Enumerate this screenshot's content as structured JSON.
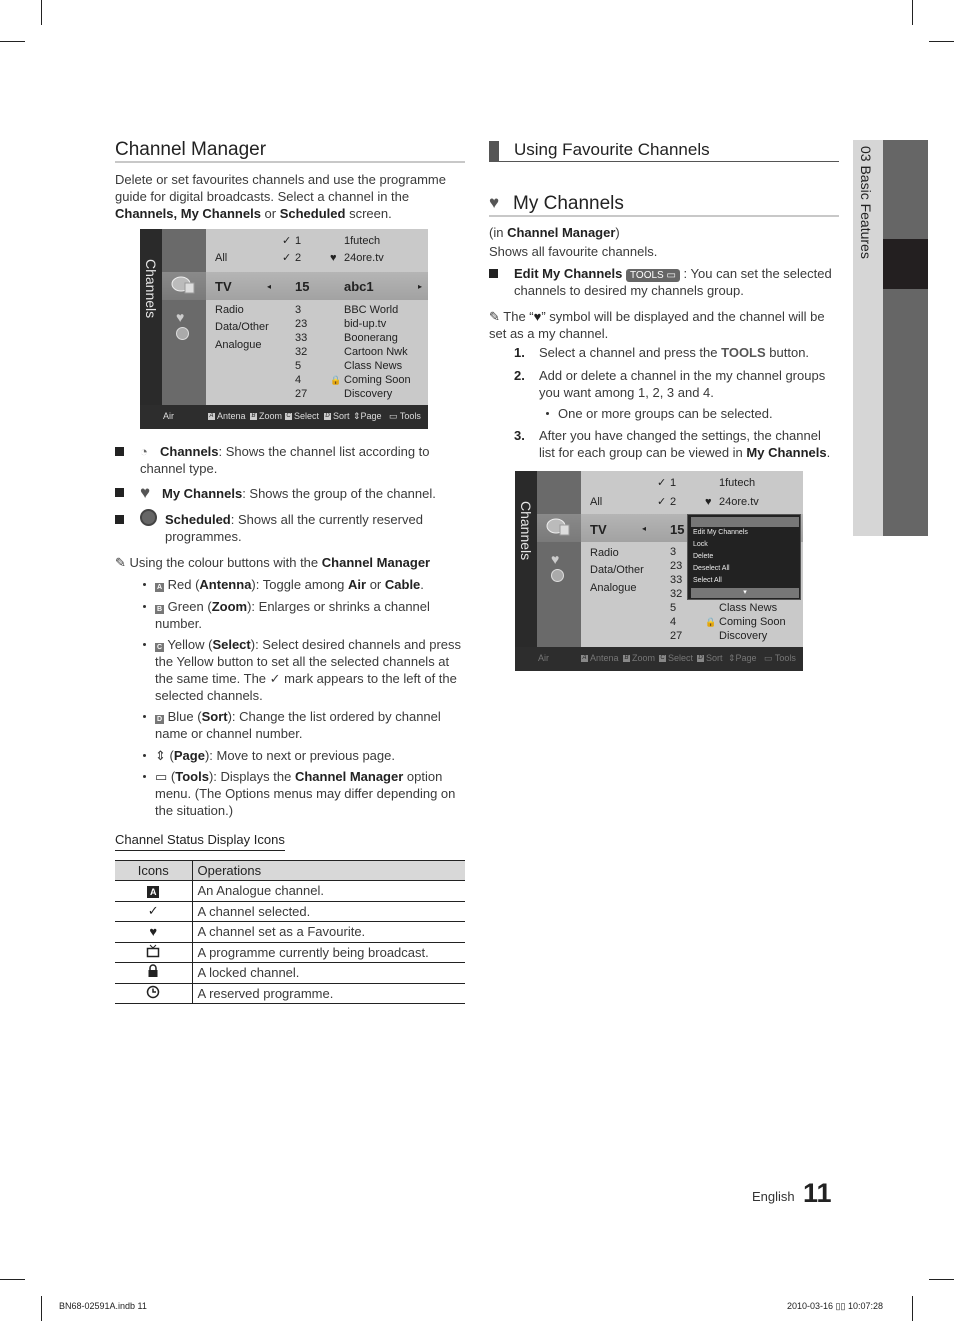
{
  "left": {
    "title": "Channel Manager",
    "intro": {
      "t1": "Delete or set favourites channels and use the programme guide for digital broadcasts. Select a channel in the ",
      "b1": "Channels, My Channels",
      "t2": " or ",
      "b2": "Scheduled",
      "t3": " screen."
    },
    "screen": {
      "side_label": "Channels",
      "categories": [
        "All",
        "TV",
        "Radio",
        "Data/Other",
        "Analogue"
      ],
      "numbers": [
        "1",
        "2",
        "15",
        "3",
        "23",
        "33",
        "32",
        "5",
        "4",
        "27"
      ],
      "names": [
        "1futech",
        "24ore.tv",
        "abc1",
        "BBC World",
        "bid-up.tv",
        "Boonerang",
        "Cartoon Nwk",
        "Class News",
        "Coming Soon",
        "Discovery"
      ],
      "footer": {
        "source": "Air",
        "items": [
          {
            "key": "A",
            "label": "Antena"
          },
          {
            "key": "B",
            "label": "Zoom"
          },
          {
            "key": "C",
            "label": "Select"
          },
          {
            "key": "D",
            "label": "Sort"
          },
          {
            "key": "◇",
            "label": "Page"
          },
          {
            "key": "tools-icon",
            "label": "Tools"
          }
        ]
      }
    },
    "bullets": [
      {
        "icon": "satellite-channels-icon",
        "bold": "Channels",
        "text": ": Shows the channel list according to channel type."
      },
      {
        "icon": "heart-icon",
        "bold": "My Channels",
        "text": ": Shows the group of the channel."
      },
      {
        "icon": "clock-icon",
        "bold": "Scheduled",
        "text": ": Shows all the currently reserved programmes."
      }
    ],
    "note": {
      "text": "Using the colour buttons with the ",
      "bold": "Channel Manager"
    },
    "colour_items": [
      {
        "key": "A",
        "pre": "Red (",
        "bold": "Antenna",
        "post": "): Toggle among ",
        "b2": "Air",
        "p2": " or ",
        "b3": "Cable",
        "p3": "."
      },
      {
        "key": "B",
        "pre": "Green (",
        "bold": "Zoom",
        "post": "): Enlarges or shrinks a channel number."
      },
      {
        "key": "C",
        "pre": "Yellow (",
        "bold": "Select",
        "post": "): Select desired channels and press the Yellow button to set all the selected channels at the same time. The ",
        "p2": " mark appears to the left of the selected channels."
      },
      {
        "key": "D",
        "pre": "Blue (",
        "bold": "Sort",
        "post": "): Change the list ordered by channel name or channel number."
      },
      {
        "key": "page-icon",
        "pre": " (",
        "bold": "Page",
        "post": "): Move to next or previous page."
      },
      {
        "key": "tools-icon",
        "pre": " (",
        "bold": "Tools",
        "post": "): Displays the ",
        "b2": "Channel Manager",
        "p2": " option menu. (The Options menus may differ depending on the situation.)"
      }
    ],
    "status_title": "Channel Status Display Icons",
    "table": {
      "headers": [
        "Icons",
        "Operations"
      ],
      "rows": [
        {
          "icon": "A",
          "op": "An Analogue channel."
        },
        {
          "icon": "✓",
          "op": "A channel selected."
        },
        {
          "icon": "♥",
          "op": "A channel set as a Favourite."
        },
        {
          "icon": "📺",
          "op": "A programme currently being broadcast."
        },
        {
          "icon": "🔒",
          "op": "A locked channel."
        },
        {
          "icon": "◷",
          "op": "A reserved programme."
        }
      ]
    }
  },
  "right": {
    "section_title": "Using Favourite Channels",
    "sub_title": "My Channels",
    "context": {
      "pre": "(in ",
      "bold": "Channel Manager",
      "post": ")"
    },
    "desc": "Shows all favourite channels.",
    "edit": {
      "bold": "Edit My Channels",
      "badge": "TOOLS",
      "text": " : You can set the selected channels to desired my channels group."
    },
    "note": {
      "pre": "The “",
      "post": "” symbol will be displayed and the channel will be set as a my channel."
    },
    "steps": [
      {
        "num": "1.",
        "pre": "Select a channel and press the ",
        "bold": "TOOLS",
        "post": " button."
      },
      {
        "num": "2.",
        "pre": "Add or delete a channel in the my channel groups you want among 1, 2, 3 and 4."
      },
      {
        "num": "3.",
        "pre": "After you have changed the settings, the channel list for each group can be viewed in ",
        "bold": "My Channels",
        "post": "."
      }
    ],
    "sub_bullet": "One or more groups can be selected.",
    "screen": {
      "menu_items": [
        "Edit My Channels",
        "Lock",
        "Delete",
        "Deselect All",
        "Select All"
      ]
    }
  },
  "tab": {
    "label": "03  Basic Features"
  },
  "footer": {
    "language": "English",
    "page": "11",
    "file": "BN68-02591A.indb   11",
    "timestamp": "2010-03-16   ▯▯ 10:07:28"
  }
}
